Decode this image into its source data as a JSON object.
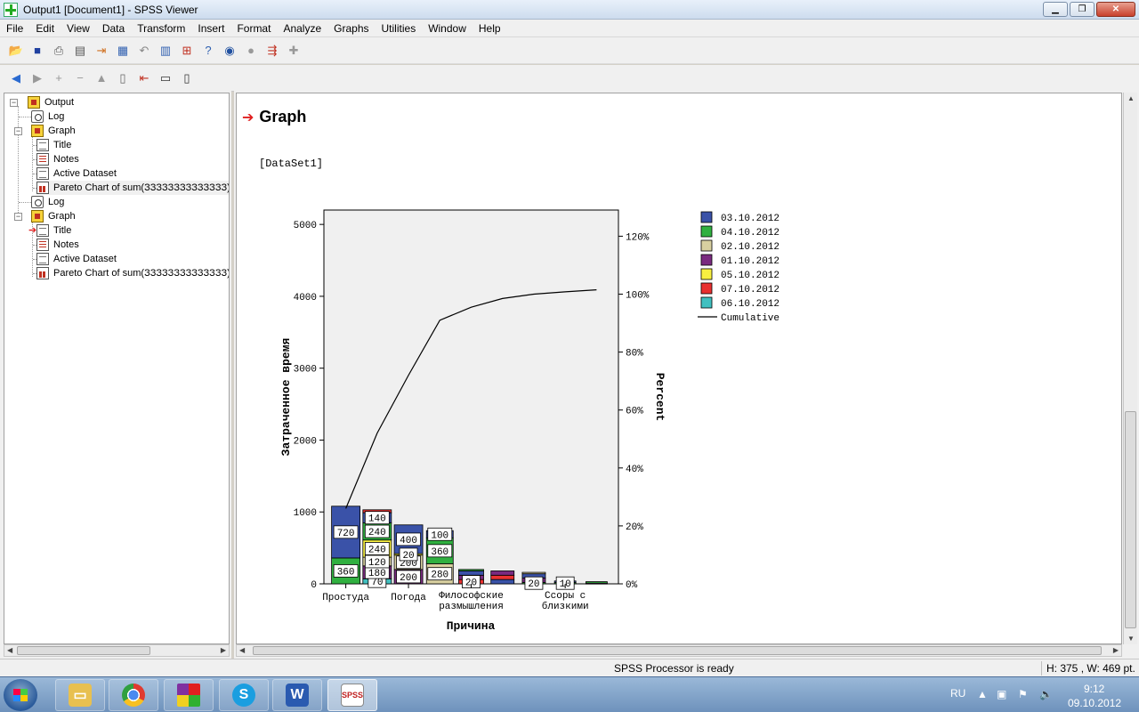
{
  "window": {
    "title": "Output1 [Document1] - SPSS Viewer"
  },
  "menu": [
    "File",
    "Edit",
    "View",
    "Data",
    "Transform",
    "Insert",
    "Format",
    "Analyze",
    "Graphs",
    "Utilities",
    "Window",
    "Help"
  ],
  "toolbar1_icons": [
    "open-folder-icon",
    "save-icon",
    "print-icon",
    "print-preview-icon",
    "export-icon",
    "goto-data-icon",
    "undo-icon",
    "goto-case-icon",
    "variables-icon",
    "help-topics-icon",
    "designate-window-icon",
    "select-cases-icon",
    "value-labels-icon",
    "insert-pivot-icon",
    "add-icon"
  ],
  "toolbar2_icons": [
    "promote-icon",
    "demote-icon",
    "expand-icon",
    "collapse-icon",
    "show-icon",
    "hide-icon",
    "insert-heading-icon",
    "insert-title-icon",
    "insert-text-icon"
  ],
  "tree": {
    "items": [
      {
        "label": "Output",
        "icon": "book-icon"
      },
      {
        "label": "Log",
        "icon": "log-icon"
      },
      {
        "label": "Graph",
        "icon": "book-icon"
      },
      {
        "label": "Title",
        "icon": "doc-icon"
      },
      {
        "label": "Notes",
        "icon": "notes-icon"
      },
      {
        "label": "Active Dataset",
        "icon": "doc-icon"
      },
      {
        "label": "Pareto Chart of sum(ЗЗЗЗЗЗЗЗЗЗЗЗЗЗ) by ЗЗЗЗЗЗ",
        "icon": "chart-icon"
      },
      {
        "label": "Log",
        "icon": "log-icon"
      },
      {
        "label": "Graph",
        "icon": "book-icon"
      },
      {
        "label": "Title",
        "icon": "doc-icon"
      },
      {
        "label": "Notes",
        "icon": "notes-icon"
      },
      {
        "label": "Active Dataset",
        "icon": "doc-icon"
      },
      {
        "label": "Pareto Chart of sum(ЗЗЗЗЗЗЗЗЗЗЗЗЗЗ) by ЗЗЗЗЗЗ V",
        "icon": "chart-icon"
      }
    ]
  },
  "output": {
    "heading": "Graph",
    "dataset": "[DataSet1]"
  },
  "chart_data": {
    "type": "bar",
    "subtype": "pareto-stacked",
    "xlabel": "Причина",
    "ylabel": "Затраченное время",
    "y2label": "Percent",
    "ylim": [
      0,
      5200
    ],
    "yticks": [
      0,
      1000,
      2000,
      3000,
      4000,
      5000
    ],
    "y2ticks": [
      "0%",
      "20%",
      "40%",
      "60%",
      "80%",
      "100%",
      "120%"
    ],
    "categories": [
      "Простуда",
      "",
      "Погода",
      "",
      "Философские размышления",
      "",
      "",
      "Ссоры с близкими",
      ""
    ],
    "series": [
      {
        "name": "03.10.2012",
        "color": "#3a52a8"
      },
      {
        "name": "04.10.2012",
        "color": "#30b040"
      },
      {
        "name": "02.10.2012",
        "color": "#d8d0a0"
      },
      {
        "name": "01.10.2012",
        "color": "#7a2a80"
      },
      {
        "name": "05.10.2012",
        "color": "#f8f040"
      },
      {
        "name": "07.10.2012",
        "color": "#e83030"
      },
      {
        "name": "06.10.2012",
        "color": "#40c0c0"
      }
    ],
    "stacks": [
      [
        [
          1,
          360
        ],
        [
          0,
          720
        ]
      ],
      [
        [
          6,
          70
        ],
        [
          3,
          180
        ],
        [
          2,
          120
        ],
        [
          4,
          240
        ],
        [
          1,
          240
        ],
        [
          0,
          140
        ],
        [
          5,
          40
        ]
      ],
      [
        [
          3,
          200
        ],
        [
          2,
          200
        ],
        [
          4,
          20
        ],
        [
          0,
          400
        ]
      ],
      [
        [
          2,
          280
        ],
        [
          1,
          360
        ],
        [
          0,
          100
        ]
      ],
      [
        [
          5,
          60
        ],
        [
          3,
          60
        ],
        [
          0,
          60
        ],
        [
          1,
          20
        ]
      ],
      [
        [
          0,
          60
        ],
        [
          5,
          60
        ],
        [
          3,
          60
        ]
      ],
      [
        [
          1,
          20
        ],
        [
          3,
          60
        ],
        [
          0,
          60
        ],
        [
          2,
          20
        ]
      ],
      [
        [
          1,
          20
        ],
        [
          0,
          20
        ]
      ],
      [
        [
          3,
          10
        ],
        [
          1,
          20
        ]
      ]
    ],
    "data_labels": [
      [
        "360",
        "720"
      ],
      [
        "70",
        "180",
        "120",
        "240",
        "240",
        "140"
      ],
      [
        "200",
        "200",
        "20",
        "400"
      ],
      [
        "280",
        "360",
        "100"
      ],
      [
        "20"
      ],
      [],
      [
        "20"
      ],
      [
        "10"
      ],
      []
    ],
    "cumulative_percent": [
      26.0,
      52.0,
      72.0,
      91.0,
      95.5,
      98.5,
      100.0,
      100.8,
      101.5
    ],
    "legend_cumulative": "Cumulative",
    "legend": "right"
  },
  "statusbar": {
    "message": "SPSS Processor is ready",
    "size": "H: 375 , W: 469  pt."
  },
  "taskbar": {
    "apps": [
      "explorer-icon",
      "chrome-icon",
      "app-icon",
      "skype-icon",
      "word-icon",
      "spss-icon"
    ],
    "lang": "RU",
    "time": "9:12",
    "date": "09.10.2012"
  }
}
